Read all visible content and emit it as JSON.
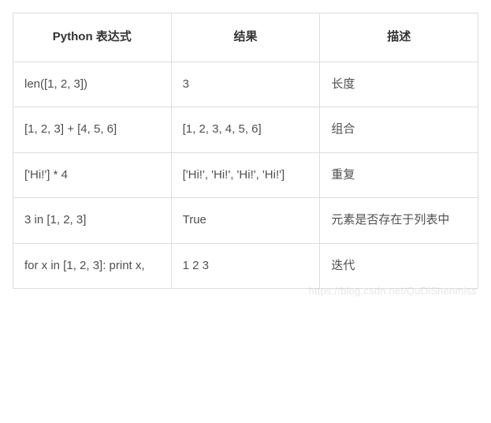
{
  "table": {
    "headers": [
      "Python 表达式",
      "结果",
      "描述"
    ],
    "rows": [
      {
        "expr": "len([1, 2, 3])",
        "result": "3",
        "desc": "长度"
      },
      {
        "expr": "[1, 2, 3] + [4, 5, 6]",
        "result": "[1, 2, 3, 4, 5, 6]",
        "desc": "组合"
      },
      {
        "expr": "['Hi!'] * 4",
        "result": "['Hi!', 'Hi!', 'Hi!', 'Hi!']",
        "desc": "重复"
      },
      {
        "expr": "3 in [1, 2, 3]",
        "result": "True",
        "desc": "元素是否存在于列表中"
      },
      {
        "expr": "for x in [1, 2, 3]: print x,",
        "result": "1 2 3",
        "desc": "迭代"
      }
    ]
  },
  "watermark": "https://blog.csdn.net/QuDiShenmiss"
}
